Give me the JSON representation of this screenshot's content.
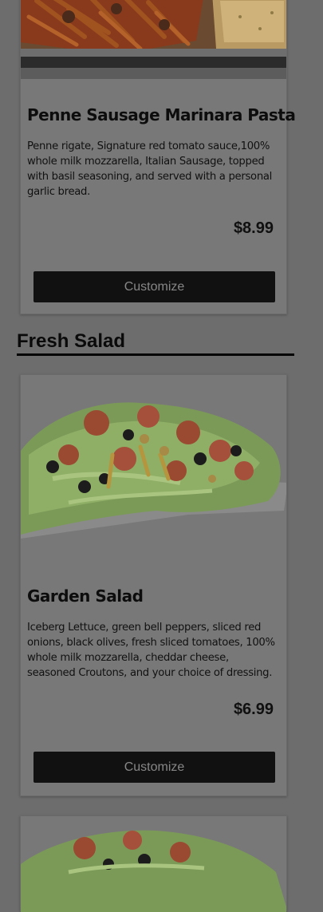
{
  "items": [
    {
      "title": "Penne Sausage Marinara Pasta",
      "description": "Penne rigate, Signature red tomato sauce,100% whole milk mozzarella, Italian Sausage, topped with basil seasoning, and served with a personal garlic bread.",
      "price": "$8.99",
      "button_label": "Customize"
    },
    {
      "title": "Garden Salad",
      "description": "Iceberg Lettuce, green bell peppers, sliced red onions, black olives, fresh sliced tomatoes, 100% whole milk mozzarella, cheddar cheese, seasoned Croutons, and your choice of dressing.",
      "price": "$6.99",
      "button_label": "Customize"
    }
  ],
  "section": {
    "title": "Fresh Salad"
  }
}
